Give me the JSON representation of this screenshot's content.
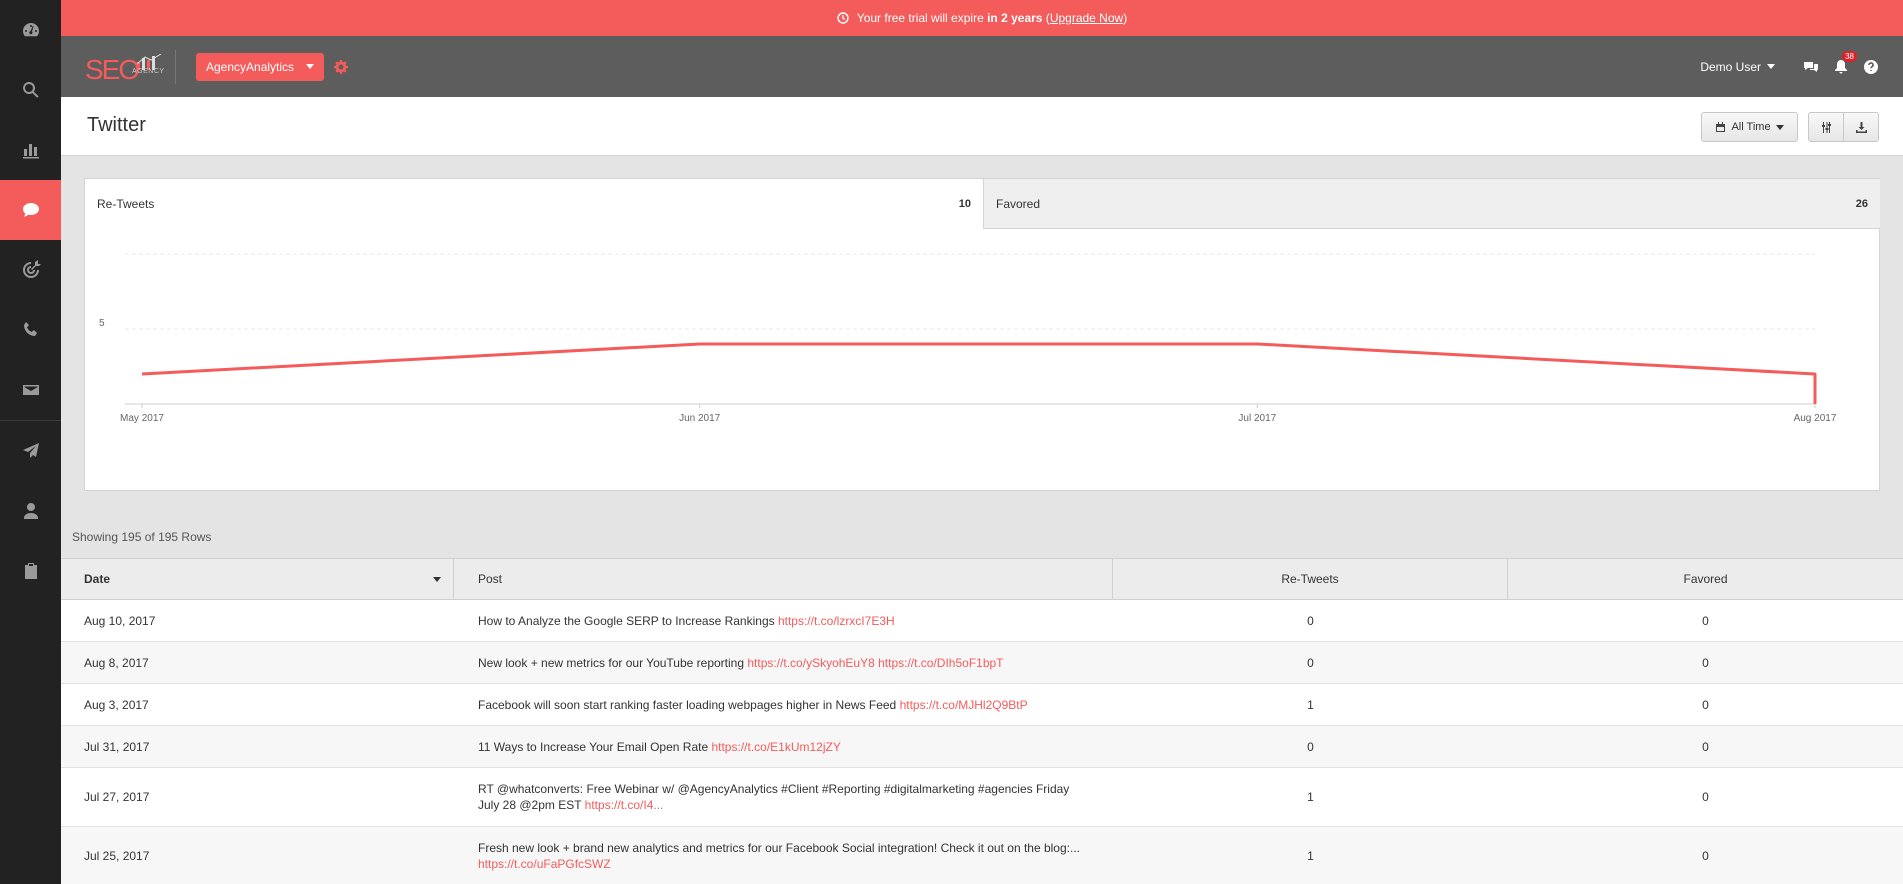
{
  "banner": {
    "prefix": "Your free trial will expire",
    "bold": "in 2 years",
    "link": "Upgrade Now"
  },
  "topbar": {
    "logo_text": "SEO",
    "logo_sub": "AGENCY",
    "agency": "AgencyAnalytics",
    "user": "Demo User",
    "notifications": "38"
  },
  "header": {
    "title": "Twitter",
    "range": "All Time"
  },
  "tabs": [
    {
      "label": "Re-Tweets",
      "value": "10"
    },
    {
      "label": "Favored",
      "value": "26"
    }
  ],
  "chart_data": {
    "type": "line",
    "x": [
      "May 2017",
      "Jun 2017",
      "Jul 2017",
      "Aug 2017"
    ],
    "series": [
      {
        "name": "Re-Tweets",
        "values": [
          2,
          4,
          4,
          2
        ]
      }
    ],
    "y_ticks": [
      "5"
    ],
    "ylim": [
      0,
      10
    ],
    "grid": true,
    "color": "#f45b5b"
  },
  "table": {
    "rows_info": "Showing 195 of 195 Rows",
    "headers": [
      "Date",
      "Post",
      "Re-Tweets",
      "Favored"
    ],
    "rows": [
      {
        "date": "Aug 10, 2017",
        "text": "How to Analyze the Google SERP to Increase Rankings ",
        "link": "https://t.co/lzrxcI7E3H",
        "retweets": "0",
        "favored": "0"
      },
      {
        "date": "Aug 8, 2017",
        "text": "New look + new metrics for our YouTube reporting ",
        "link": "https://t.co/ySkyohEuY8 https://t.co/DIh5oF1bpT",
        "retweets": "0",
        "favored": "0"
      },
      {
        "date": "Aug 3, 2017",
        "text": "Facebook will soon start ranking faster loading webpages higher in News Feed ",
        "link": "https://t.co/MJHl2Q9BtP",
        "retweets": "1",
        "favored": "0"
      },
      {
        "date": "Jul 31, 2017",
        "text": "11 Ways to Increase Your Email Open Rate ",
        "link": "https://t.co/E1kUm12jZY",
        "retweets": "0",
        "favored": "0"
      },
      {
        "date": "Jul 27, 2017",
        "text": "RT @whatconverts: Free Webinar w/ @AgencyAnalytics #Client #Reporting #digitalmarketing #agencies Friday July 28 @2pm EST ",
        "link": "https://t.co/I4...",
        "retweets": "1",
        "favored": "0"
      },
      {
        "date": "Jul 25, 2017",
        "text": "Fresh new look + brand new analytics and metrics for our Facebook Social integration! Check it out on the blog:... ",
        "link": "https://t.co/uFaPGfcSWZ",
        "retweets": "1",
        "favored": "0"
      }
    ]
  }
}
